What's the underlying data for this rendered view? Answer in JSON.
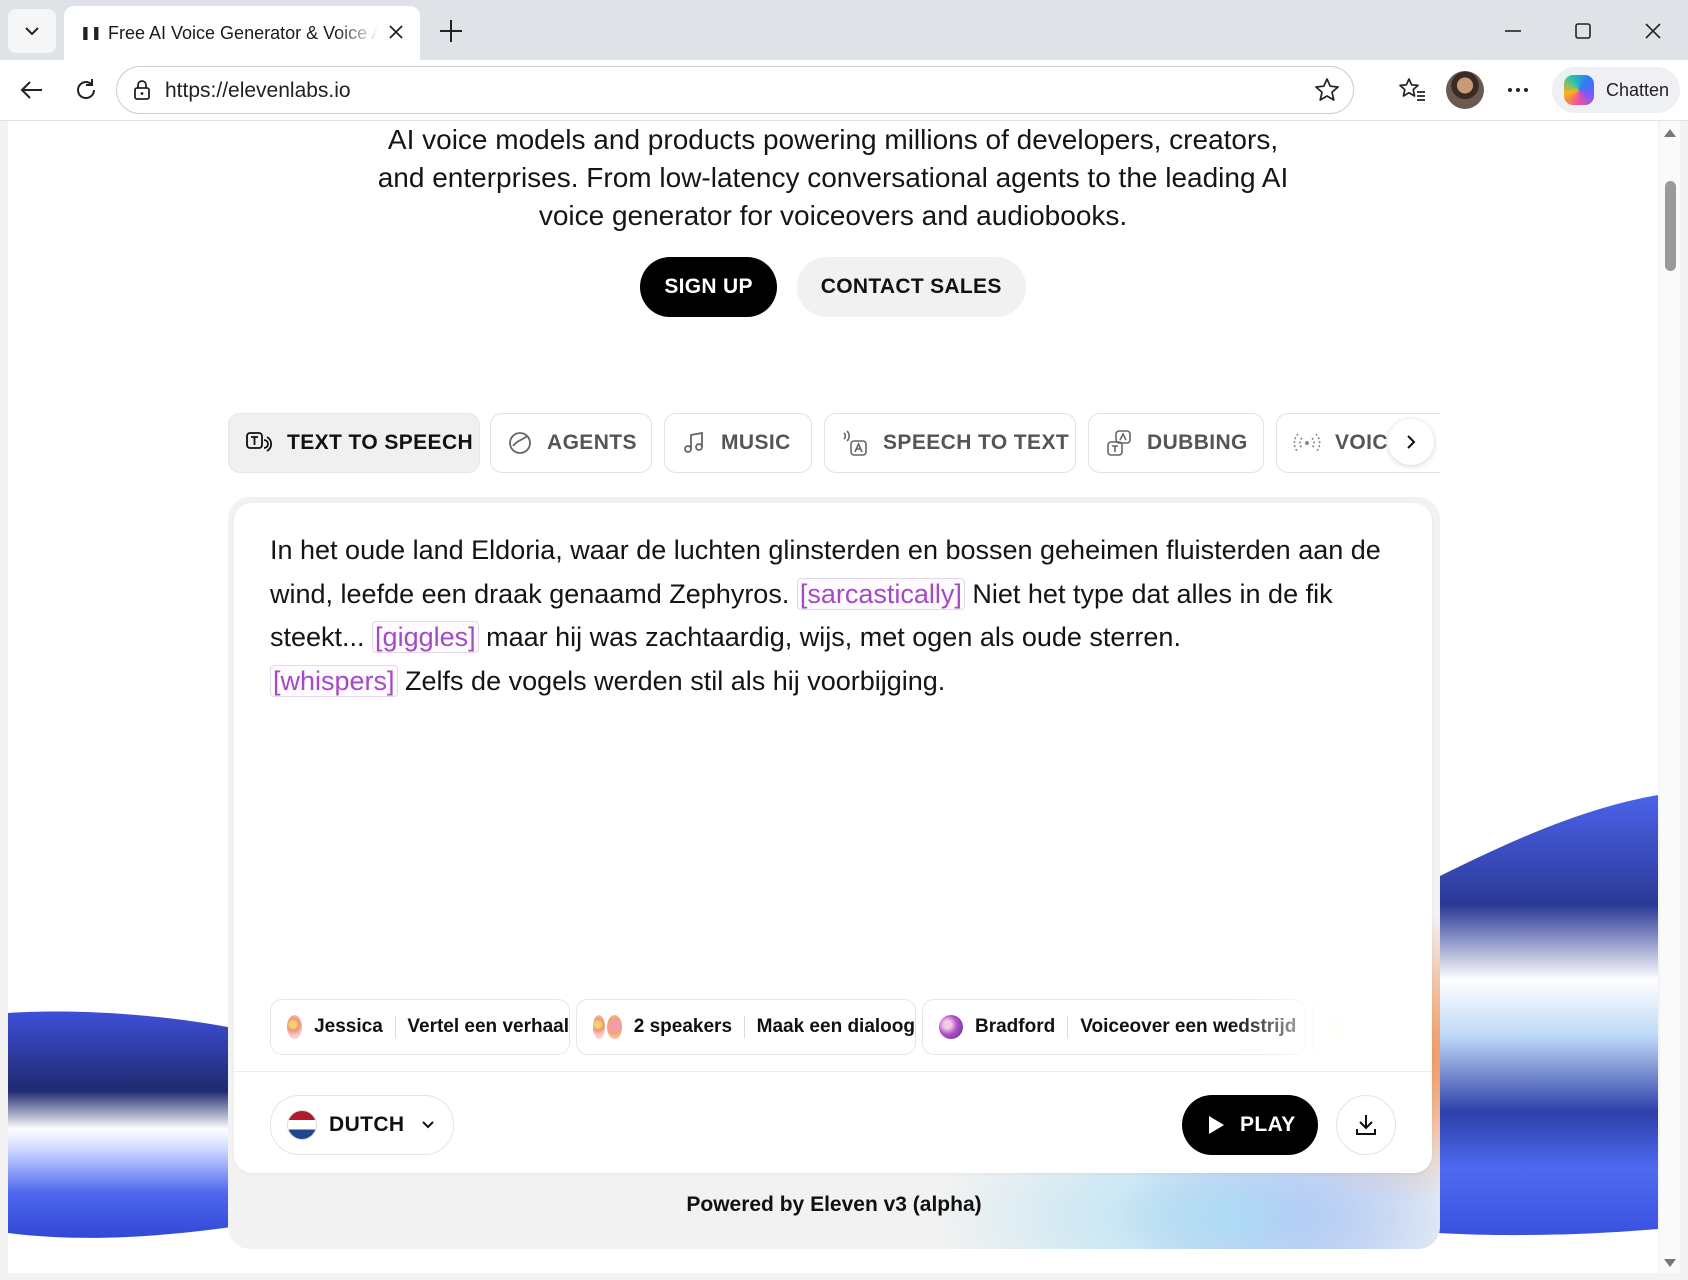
{
  "browser": {
    "tab_title": "Free AI Voice Generator & Voice Agents Platform | ElevenLabs",
    "url": "https://elevenlabs.io",
    "chat_label": "Chatten"
  },
  "page": {
    "intro_lines": [
      "AI voice models and products powering millions of developers, creators,",
      "and enterprises. From low-latency conversational agents to the leading AI",
      "voice generator for voiceovers and audiobooks."
    ],
    "signup_label": "SIGN UP",
    "contact_label": "CONTACT SALES",
    "product_tabs": [
      {
        "label": "TEXT TO SPEECH",
        "icon": "text-to-speech-icon",
        "active": true
      },
      {
        "label": "AGENTS",
        "icon": "agents-icon",
        "active": false
      },
      {
        "label": "MUSIC",
        "icon": "music-note-icon",
        "active": false
      },
      {
        "label": "SPEECH TO TEXT",
        "icon": "speech-to-text-icon",
        "active": false
      },
      {
        "label": "DUBBING",
        "icon": "dubbing-icon",
        "active": false
      },
      {
        "label": "VOICE",
        "icon": "voice-icon",
        "active": false
      }
    ],
    "editor": {
      "t1": "In het oude land Eldoria, waar de luchten glinsterden en bossen geheimen fluisterden aan de wind, leefde een draak genaamd Zephyros. ",
      "tag1": "[sarcastically]",
      "t2": " Niet het type dat alles in de fik steekt... ",
      "tag2": "[giggles]",
      "t3": " maar hij was zachtaardig, wijs, met ogen als oude sterren. ",
      "tag3": "[whispers]",
      "t4": " Zelfs de vogels werden stil als hij voorbijging."
    },
    "presets": [
      {
        "voice": "Jessica",
        "task": "Vertel een verhaal"
      },
      {
        "voice": "2 speakers",
        "task": "Maak een dialoog"
      },
      {
        "voice": "Bradford",
        "task": "Voiceover een wedstrijd"
      }
    ],
    "language": "DUTCH",
    "play_label": "PLAY",
    "powered_by": "Powered by Eleven v3 (alpha)"
  },
  "colors": {
    "tag": "#a34ac4",
    "wave_blue": "#3b55e6",
    "accent_orange": "#f38444"
  }
}
